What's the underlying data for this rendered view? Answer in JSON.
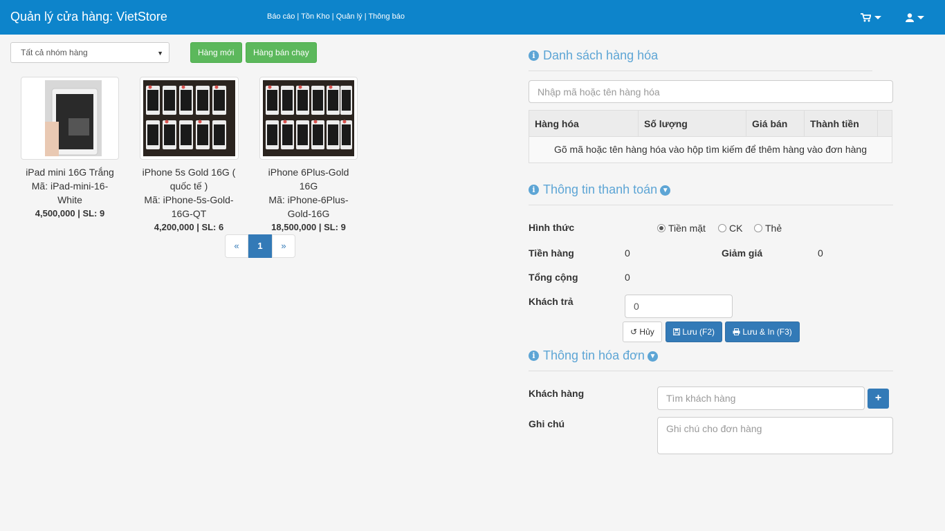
{
  "navbar": {
    "title": "Quản lý cửa hàng: VietStore",
    "links": [
      "Báo cáo",
      "Tồn Kho",
      "Quản lý",
      "Thông báo"
    ],
    "cart_icon": "shopping-cart-icon",
    "user_icon": "user-icon"
  },
  "filter": {
    "group_select": "Tất cả nhóm hàng",
    "btn_new": "Hàng mới",
    "btn_best": "Hàng bán chạy"
  },
  "products": [
    {
      "name": "iPad mini 16G Trắng",
      "code": "Mã: iPad-mini-16-White",
      "price_qty": "4,500,000 | SL: 9"
    },
    {
      "name": "iPhone 5s Gold 16G ( quốc tế )",
      "code": "Mã: iPhone-5s-Gold-16G-QT",
      "price_qty": "4,200,000 | SL: 6"
    },
    {
      "name": "iPhone 6Plus-Gold 16G",
      "code": "Mã: iPhone-6Plus-Gold-16G",
      "price_qty": "18,500,000 | SL: 9"
    }
  ],
  "pagination": {
    "prev": "«",
    "current": "1",
    "next": "»"
  },
  "goods_list": {
    "title": "Danh sách hàng hóa",
    "search_placeholder": "Nhập mã hoặc tên hàng hóa",
    "columns": [
      "Hàng hóa",
      "Số lượng",
      "Giá bán",
      "Thành tiền"
    ],
    "empty_message": "Gõ mã hoặc tên hàng hóa vào hộp tìm kiếm để thêm hàng vào đơn hàng"
  },
  "payment": {
    "title": "Thông tin thanh toán",
    "method_label": "Hình thức",
    "methods": [
      "Tiền mặt",
      "CK",
      "Thẻ"
    ],
    "selected_method": "Tiền mặt",
    "subtotal_label": "Tiền hàng",
    "subtotal_value": "0",
    "discount_label": "Giảm giá",
    "discount_value": "0",
    "total_label": "Tổng cộng",
    "total_value": "0",
    "paid_label": "Khách trả",
    "paid_value": "0",
    "btn_cancel": "Hủy",
    "btn_save": "Lưu (F2)",
    "btn_save_print": "Lưu & In (F3)"
  },
  "invoice": {
    "title": "Thông tin hóa đơn",
    "customer_label": "Khách hàng",
    "customer_placeholder": "Tìm khách hàng",
    "note_label": "Ghi chú",
    "note_placeholder": "Ghi chú cho đơn hàng"
  },
  "colors": {
    "navbar": "#0d84cb",
    "green": "#5cb85c",
    "primary": "#337ab7",
    "section_title": "#5da5d5"
  }
}
